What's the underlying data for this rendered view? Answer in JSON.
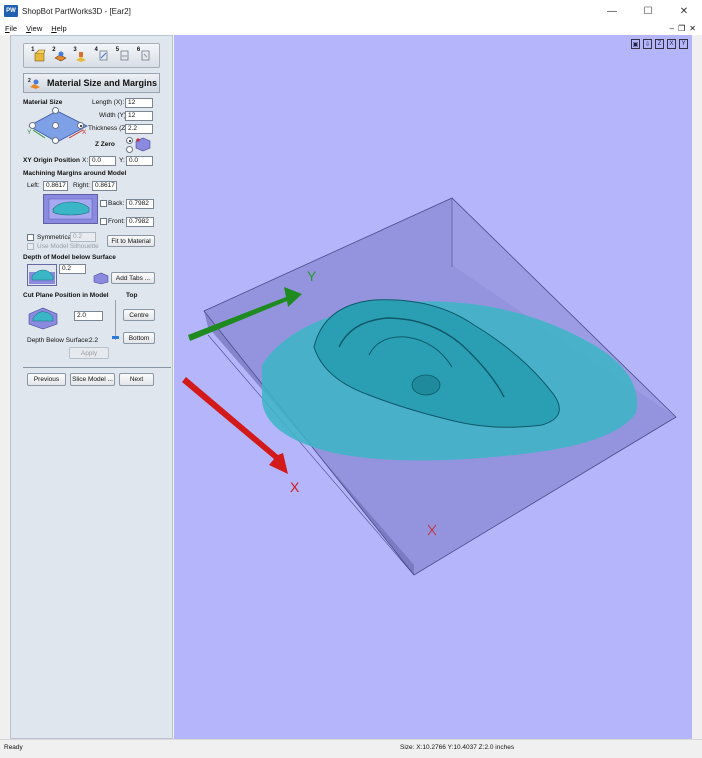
{
  "window": {
    "app_badge": "PW",
    "title": "ShopBot PartWorks3D - [Ear2]",
    "minimize": "—",
    "maximize": "☐",
    "close": "✕"
  },
  "menu": {
    "items": [
      "File",
      "View",
      "Help"
    ],
    "mdi_minimize": "–",
    "mdi_restore": "❐",
    "mdi_close": "✕"
  },
  "toolbar": {
    "steps": [
      "1",
      "2",
      "3",
      "4",
      "5",
      "6"
    ]
  },
  "section": {
    "number": "2",
    "title": "Material Size and Margins"
  },
  "material_size": {
    "heading": "Material Size",
    "length_label": "Length (X):",
    "length_value": "12",
    "width_label": "Width (Y):",
    "width_value": "12",
    "thickness_label": "Thickness (Z):",
    "thickness_value": "2.2",
    "z_zero_label": "Z Zero",
    "axis_y": "Y",
    "axis_x": "X"
  },
  "xy_origin": {
    "heading": "XY Origin Position",
    "x_label": "X:",
    "x_value": "0.0",
    "y_label": "Y:",
    "y_value": "0.0"
  },
  "margins": {
    "heading": "Machining Margins around Model",
    "left_label": "Left:",
    "left_value": "0.8617",
    "right_label": "Right:",
    "right_value": "0.8617",
    "back_label": "Back:",
    "back_value": "0.7982",
    "front_label": "Front:",
    "front_value": "0.7982",
    "symmetrical_label": "Symmetrical",
    "symmetrical_value": "0.2",
    "silhouette_label": "Use Model Silhouette",
    "fit_button": "Fit to Material"
  },
  "depth": {
    "heading": "Depth of Model below Surface",
    "value": "0.2",
    "add_tabs_button": "Add Tabs ..."
  },
  "cut_plane": {
    "heading": "Cut Plane Position in Model",
    "top_label": "Top",
    "value": "2.0",
    "centre_button": "Centre",
    "bottom_button": "Bottom",
    "depth_label": "Depth Below Surface:",
    "depth_value": "2.2",
    "apply_button": "Apply"
  },
  "nav": {
    "previous": "Previous",
    "slice": "Slice Model ...",
    "next": "Next"
  },
  "viewport": {
    "tools": [
      "▣",
      "⇩",
      "Z",
      "X",
      "Y"
    ],
    "axis_x": "X",
    "axis_y": "Y"
  },
  "status": {
    "left": "Ready",
    "size": "Size: X:10.2766 Y:10.4037 Z:2.0 inches"
  },
  "colors": {
    "viewport_bg": "#b5b5fb",
    "model": "#3bb6c6",
    "x_arrow": "#d21a1a",
    "y_arrow": "#1f8a1f"
  }
}
